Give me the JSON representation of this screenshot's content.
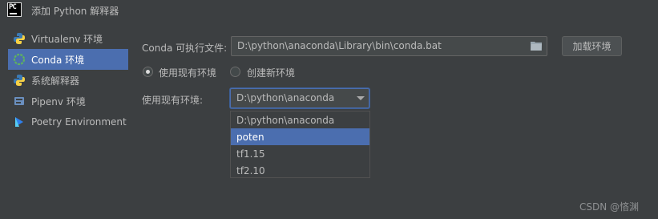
{
  "window": {
    "title": "添加 Python 解释器",
    "app_icon_text": "PC"
  },
  "sidebar": {
    "items": [
      {
        "label": "Virtualenv 环境",
        "icon": "python-icon",
        "selected": false
      },
      {
        "label": "Conda 环境",
        "icon": "conda-icon",
        "selected": true
      },
      {
        "label": "系统解释器",
        "icon": "python-icon",
        "selected": false
      },
      {
        "label": "Pipenv 环境",
        "icon": "pipenv-icon",
        "selected": false
      },
      {
        "label": "Poetry Environment",
        "icon": "poetry-icon",
        "selected": false
      }
    ]
  },
  "form": {
    "conda_exe_label": "Conda 可执行文件:",
    "conda_exe_value": "D:\\python\\anaconda\\Library\\bin\\conda.bat",
    "load_button": "加载环境",
    "radio_existing": "使用现有环境",
    "radio_new": "创建新环境",
    "existing_env_label": "使用现有环境:",
    "existing_env_value": "D:\\python\\anaconda",
    "dropdown_options": [
      "D:\\python\\anaconda",
      "poten",
      "tf1.15",
      "tf2.10"
    ],
    "dropdown_highlighted": "poten"
  },
  "watermark": "CSDN @悋渊",
  "colors": {
    "accent": "#4b6eaf",
    "background": "#3c3f41"
  }
}
